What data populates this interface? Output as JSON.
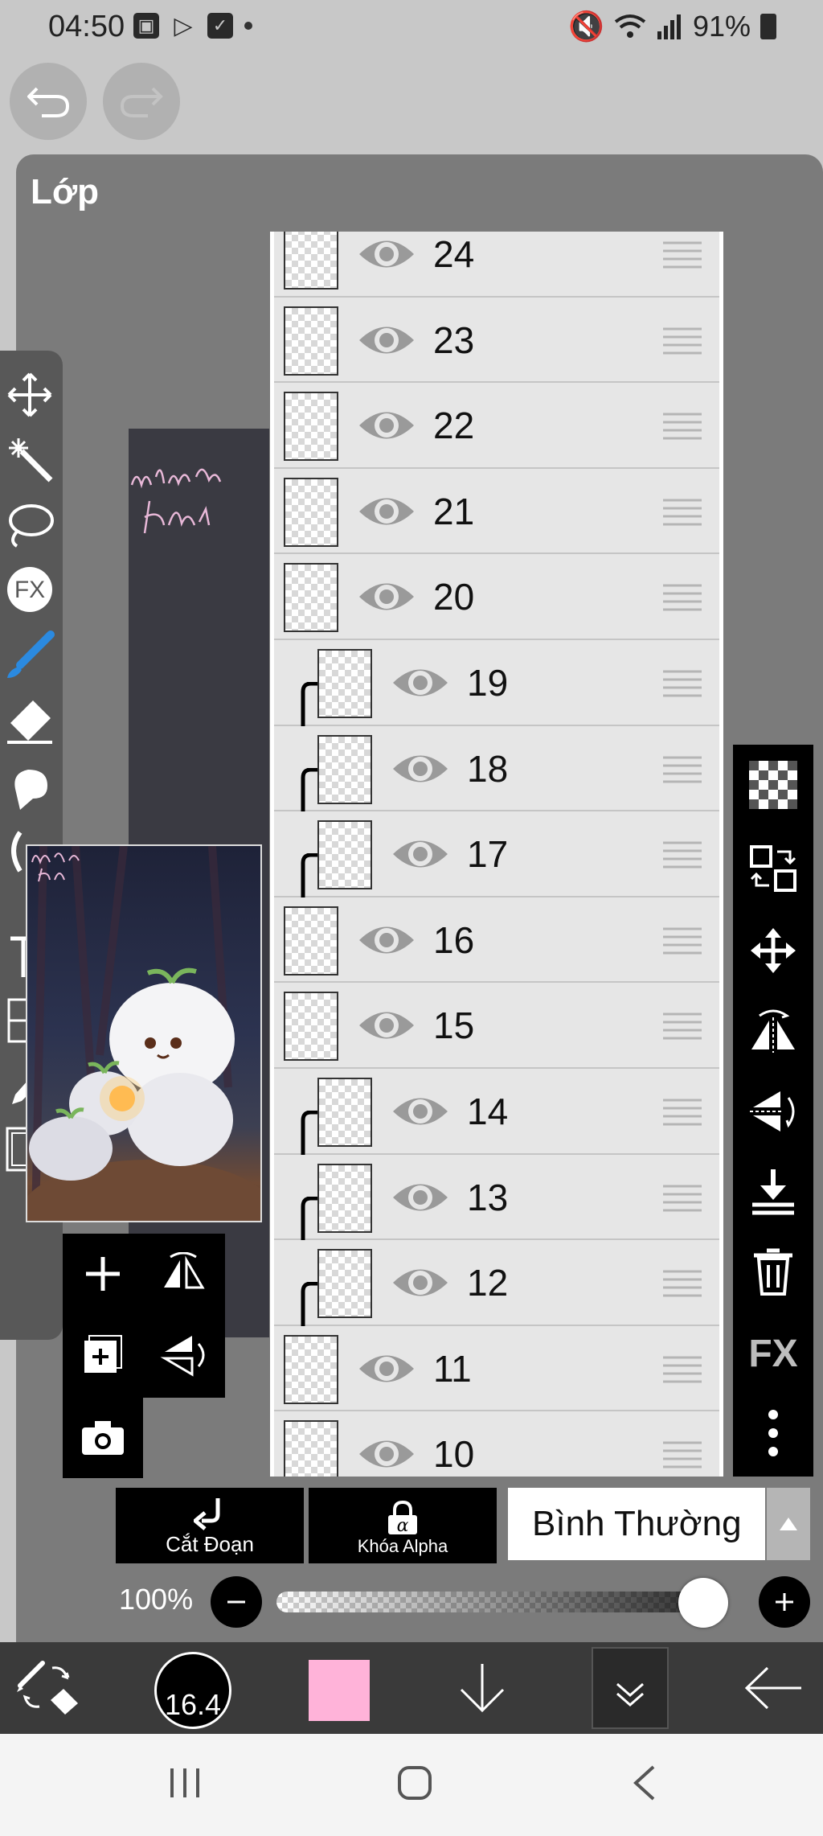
{
  "status_bar": {
    "time": "04:50",
    "battery": "91%"
  },
  "panel": {
    "title": "Lớp"
  },
  "layers": [
    {
      "name": "24",
      "clipped": false
    },
    {
      "name": "23",
      "clipped": false
    },
    {
      "name": "22",
      "clipped": false
    },
    {
      "name": "21",
      "clipped": false
    },
    {
      "name": "20",
      "clipped": false
    },
    {
      "name": "19",
      "clipped": true
    },
    {
      "name": "18",
      "clipped": true
    },
    {
      "name": "17",
      "clipped": true
    },
    {
      "name": "16",
      "clipped": false
    },
    {
      "name": "15",
      "clipped": false
    },
    {
      "name": "14",
      "clipped": true
    },
    {
      "name": "13",
      "clipped": true
    },
    {
      "name": "12",
      "clipped": true
    },
    {
      "name": "11",
      "clipped": false
    },
    {
      "name": "10",
      "clipped": false
    }
  ],
  "controls": {
    "clipping_label": "Cắt Đoạn",
    "alpha_lock_label": "Khóa Alpha",
    "blend_mode": "Bình Thường",
    "opacity": "100%",
    "opacity_fraction": 1.0
  },
  "bottom_bar": {
    "brush_size": "16.4",
    "current_color": "#ffb3d9"
  },
  "colors": {
    "panel_bg": "#7b7b7b",
    "toolbar_bg": "#000000",
    "accent_brush": "#2b8ae0"
  }
}
